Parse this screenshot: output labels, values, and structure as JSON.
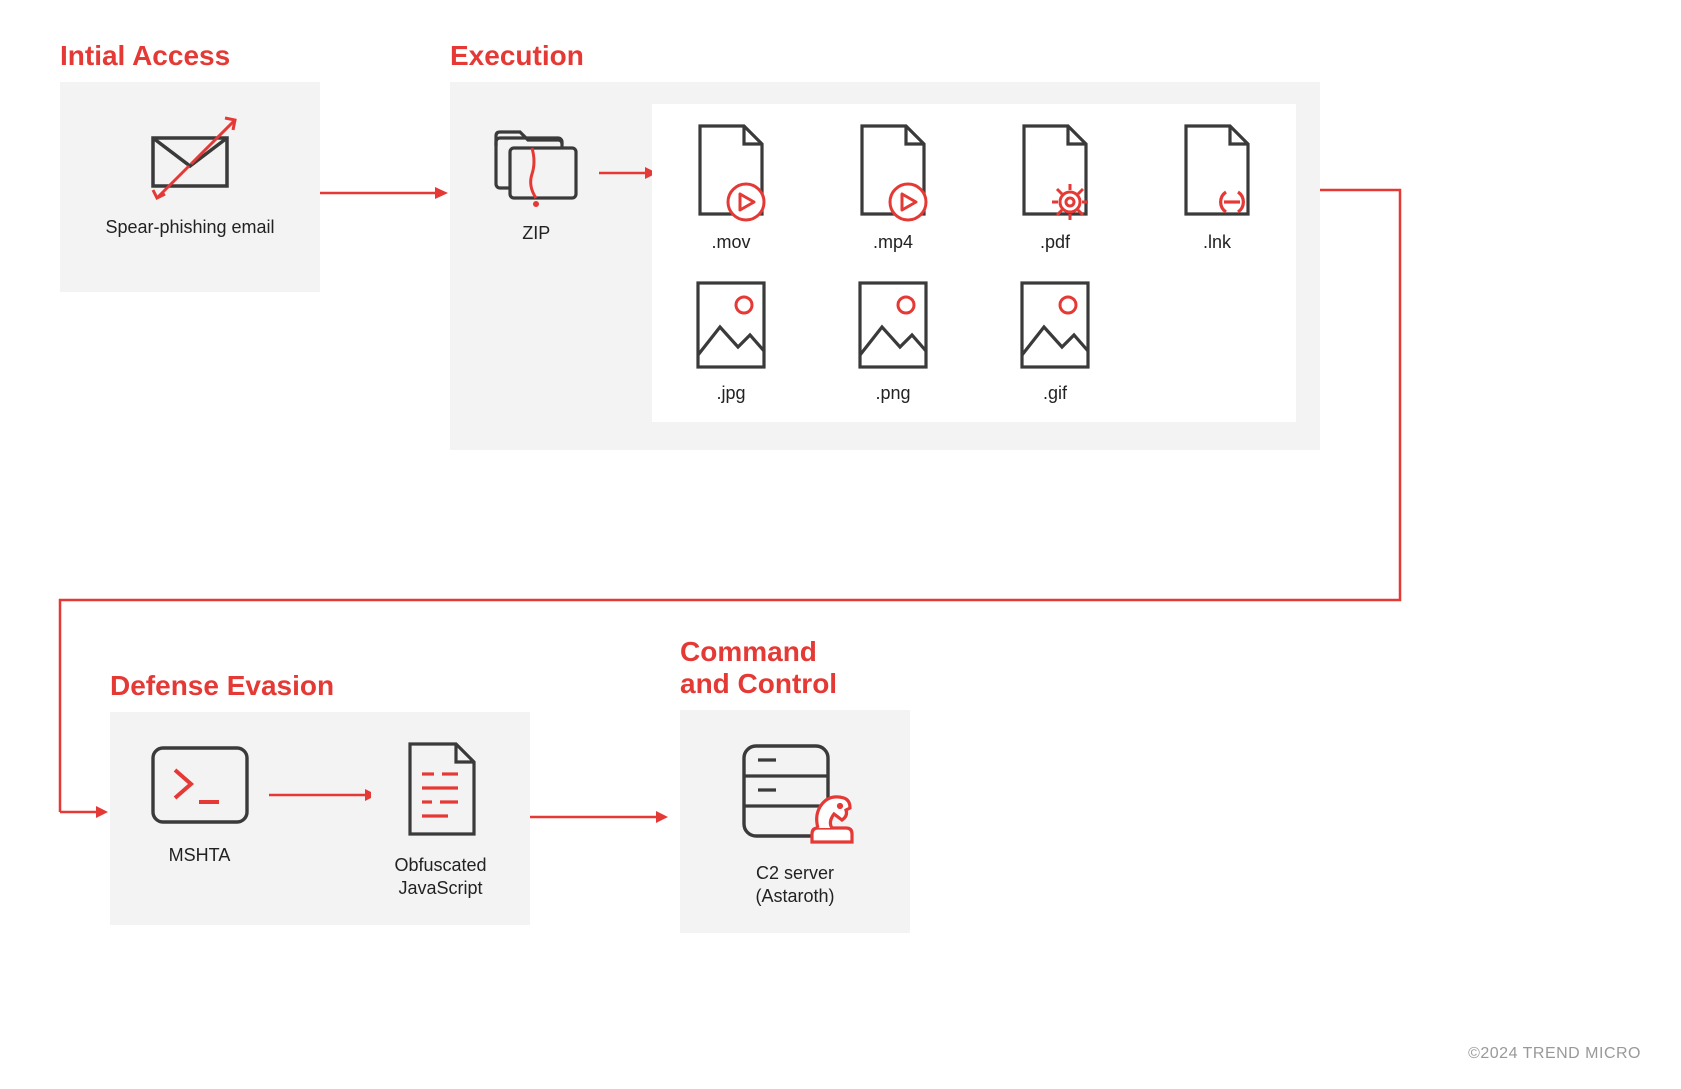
{
  "stages": {
    "initial_access": {
      "title": "Intial Access",
      "item_label": "Spear-phishing email"
    },
    "execution": {
      "title": "Execution",
      "zip_label": "ZIP",
      "files_row1": [
        ".mov",
        ".mp4",
        ".pdf",
        ".lnk"
      ],
      "files_row2": [
        ".jpg",
        ".png",
        ".gif"
      ]
    },
    "defense_evasion": {
      "title": "Defense Evasion",
      "mshta_label": "MSHTA",
      "js_label": "Obfuscated\nJavaScript"
    },
    "command_control": {
      "title": "Command\nand Control",
      "c2_label": "C2 server\n(Astaroth)"
    }
  },
  "copyright": "©2024 TREND MICRO",
  "colors": {
    "accent": "#e53935",
    "dark": "#3a3a3a",
    "bg": "#f3f3f3"
  }
}
